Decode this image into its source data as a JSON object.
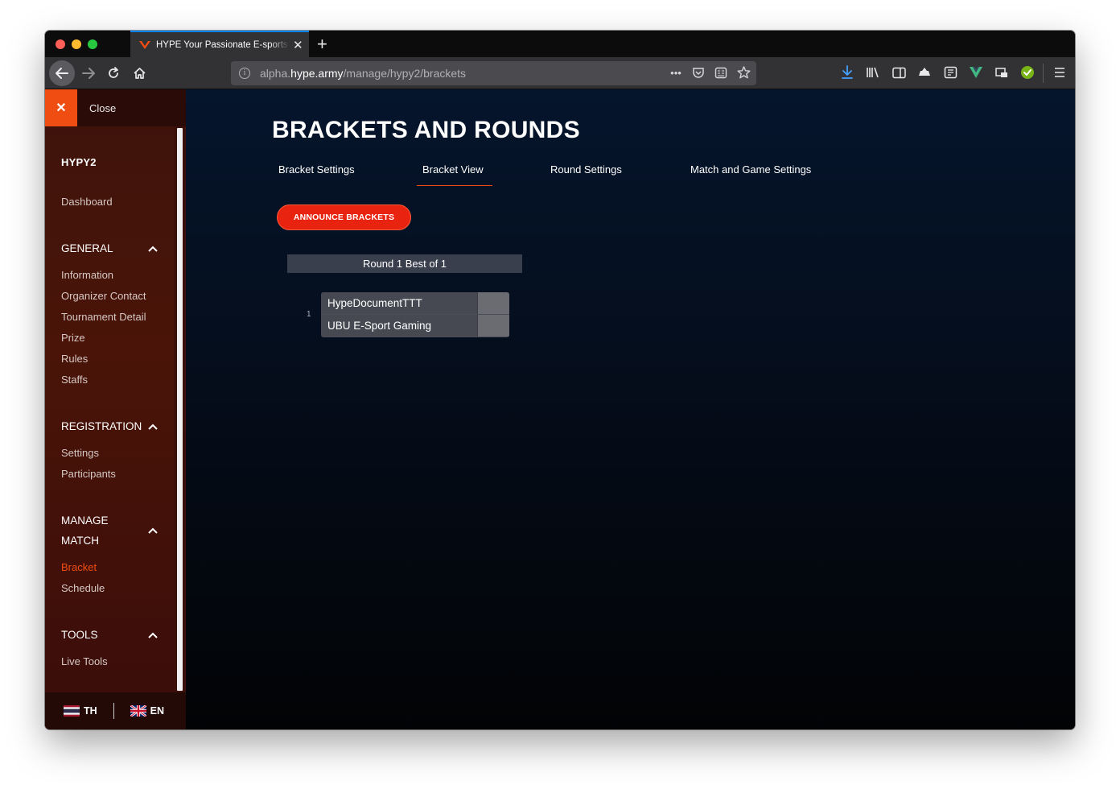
{
  "browser": {
    "tab_title": "HYPE Your Passionate E-sports",
    "url_prefix": "alpha.",
    "url_host": "hype.army",
    "url_path": "/manage/hypy2/brackets"
  },
  "sidebar": {
    "close_label": "Close",
    "tournament_name": "HYPY2",
    "dashboard_label": "Dashboard",
    "sections": [
      {
        "title": "GENERAL",
        "items": [
          "Information",
          "Organizer Contact",
          "Tournament Detail",
          "Prize",
          "Rules",
          "Staffs"
        ]
      },
      {
        "title": "REGISTRATION",
        "items": [
          "Settings",
          "Participants"
        ]
      },
      {
        "title_line1": "MANAGE",
        "title_line2": "MATCH",
        "items": [
          "Bracket",
          "Schedule"
        ],
        "active_item": "Bracket"
      },
      {
        "title": "TOOLS",
        "items": [
          "Live Tools"
        ]
      }
    ],
    "languages": [
      "TH",
      "EN"
    ]
  },
  "main": {
    "title": "BRACKETS AND ROUNDS",
    "tabs": [
      "Bracket Settings",
      "Bracket View",
      "Round Settings",
      "Match and Game Settings"
    ],
    "active_tab": "Bracket View",
    "announce_button": "ANNOUNCE BRACKETS",
    "round_header": "Round 1 Best of 1",
    "matches": [
      {
        "number": "1",
        "team1": "HypeDocumentTTT",
        "team2": "UBU E-Sport Gaming",
        "score1": "",
        "score2": ""
      }
    ]
  },
  "colors": {
    "accent": "#f04d12",
    "sidebar_bg": "#4a1408",
    "page_bg": "#05152c",
    "button_bg": "#e8230f"
  }
}
